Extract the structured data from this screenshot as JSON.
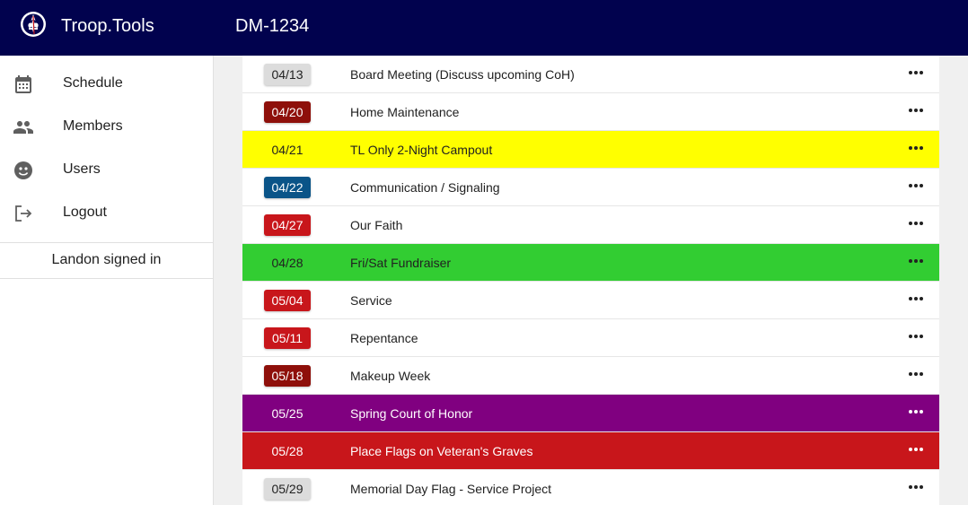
{
  "header": {
    "app_title": "Troop.Tools",
    "unit_title": "DM-1234"
  },
  "sidebar": {
    "items": [
      {
        "label": "Schedule",
        "icon": "calendar-icon"
      },
      {
        "label": "Members",
        "icon": "people-icon"
      },
      {
        "label": "Users",
        "icon": "face-icon"
      },
      {
        "label": "Logout",
        "icon": "logout-icon"
      }
    ],
    "signed_in": "Landon signed in"
  },
  "events": [
    {
      "date": "04/13",
      "title": "Board Meeting (Discuss upcoming CoH)",
      "row_bg": "#ffffff",
      "row_fg": "#212121",
      "chip_bg": "#dcdcdc",
      "chip_fg": "#212121"
    },
    {
      "date": "04/20",
      "title": "Home Maintenance",
      "row_bg": "#ffffff",
      "row_fg": "#212121",
      "chip_bg": "#8e0f0a",
      "chip_fg": "#ffffff"
    },
    {
      "date": "04/21",
      "title": "TL Only 2-Night Campout",
      "row_bg": "#ffff00",
      "row_fg": "#212121",
      "chip_bg": "transparent",
      "chip_fg": "#212121"
    },
    {
      "date": "04/22",
      "title": "Communication / Signaling",
      "row_bg": "#ffffff",
      "row_fg": "#212121",
      "chip_bg": "#0a5488",
      "chip_fg": "#ffffff"
    },
    {
      "date": "04/27",
      "title": "Our Faith",
      "row_bg": "#ffffff",
      "row_fg": "#212121",
      "chip_bg": "#c8161b",
      "chip_fg": "#ffffff"
    },
    {
      "date": "04/28",
      "title": "Fri/Sat Fundraiser",
      "row_bg": "#32cd32",
      "row_fg": "#212121",
      "chip_bg": "transparent",
      "chip_fg": "#212121"
    },
    {
      "date": "05/04",
      "title": "Service",
      "row_bg": "#ffffff",
      "row_fg": "#212121",
      "chip_bg": "#c8161b",
      "chip_fg": "#ffffff"
    },
    {
      "date": "05/11",
      "title": "Repentance",
      "row_bg": "#ffffff",
      "row_fg": "#212121",
      "chip_bg": "#c8161b",
      "chip_fg": "#ffffff"
    },
    {
      "date": "05/18",
      "title": "Makeup Week",
      "row_bg": "#ffffff",
      "row_fg": "#212121",
      "chip_bg": "#8e0f0a",
      "chip_fg": "#ffffff"
    },
    {
      "date": "05/25",
      "title": "Spring Court of Honor",
      "row_bg": "#800080",
      "row_fg": "#ffffff",
      "chip_bg": "transparent",
      "chip_fg": "#ffffff"
    },
    {
      "date": "05/28",
      "title": "Place Flags on Veteran's Graves",
      "row_bg": "#c8161b",
      "row_fg": "#ffffff",
      "chip_bg": "transparent",
      "chip_fg": "#ffffff"
    },
    {
      "date": "05/29",
      "title": "Memorial Day Flag - Service Project",
      "row_bg": "#ffffff",
      "row_fg": "#212121",
      "chip_bg": "#dcdcdc",
      "chip_fg": "#212121"
    }
  ]
}
